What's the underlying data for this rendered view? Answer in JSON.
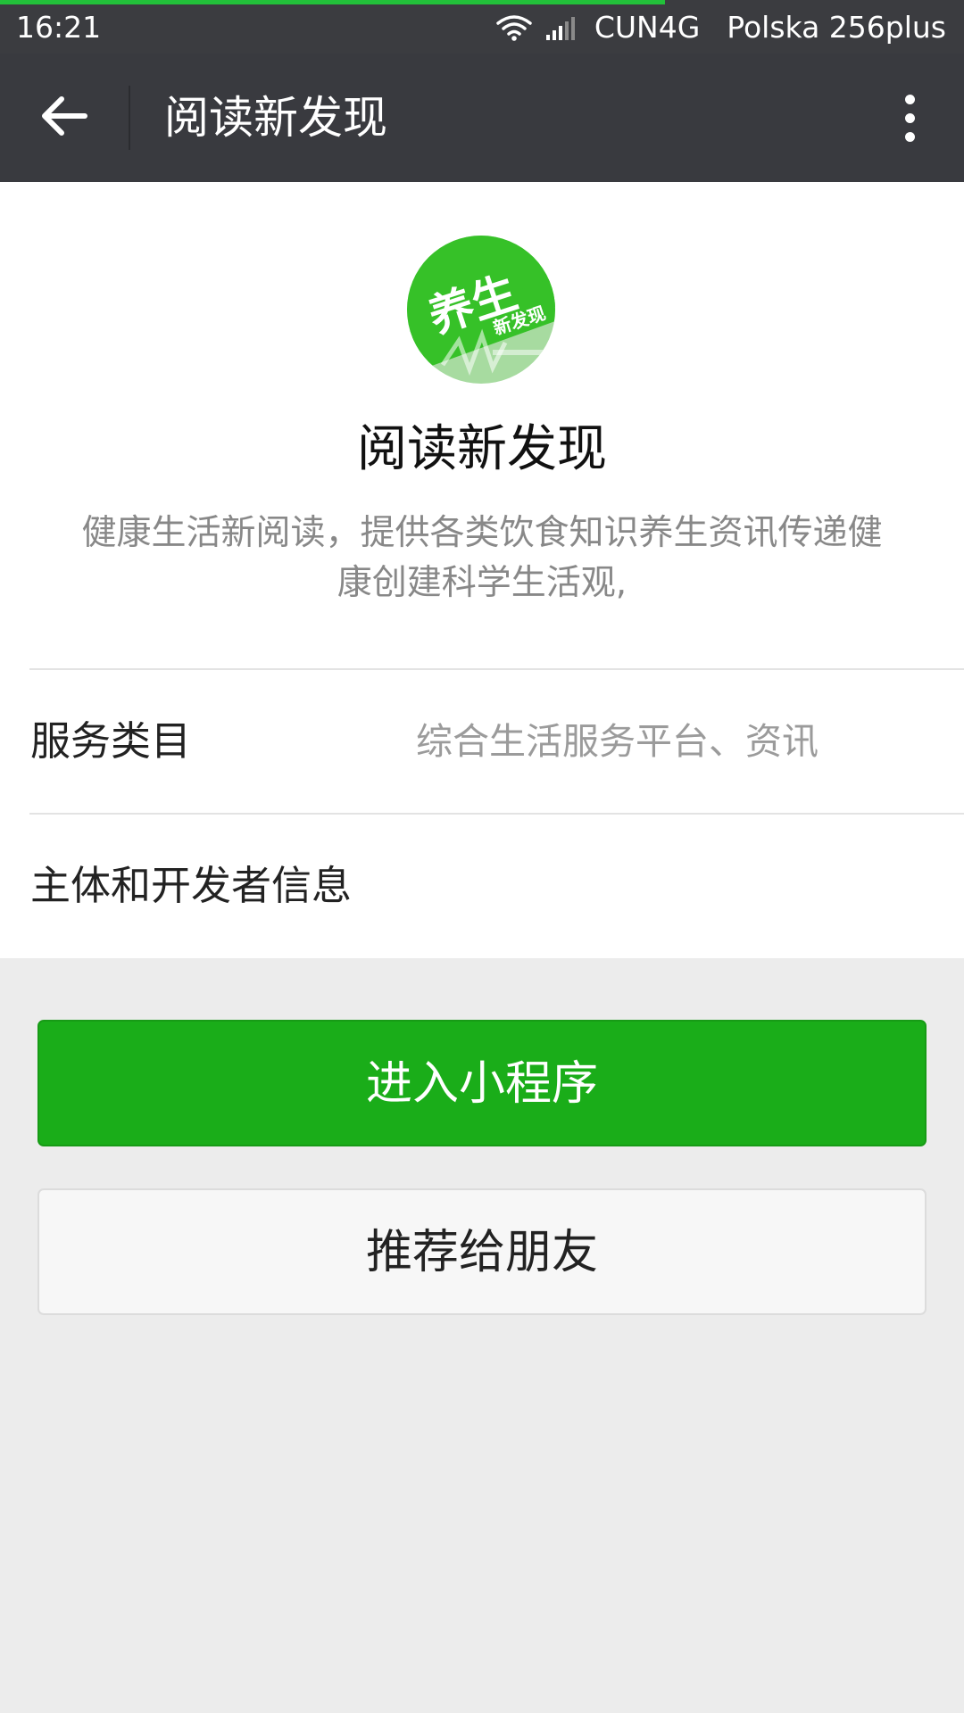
{
  "status_bar": {
    "time": "16:21",
    "carrier": "CUN4G",
    "carrier2": "Polska 256plus",
    "load_progress_percent": 69
  },
  "action_bar": {
    "title": "阅读新发现"
  },
  "profile": {
    "logo": {
      "big_text": "养生",
      "small_text": "新发现",
      "color": "#36c128"
    },
    "name": "阅读新发现",
    "description_line1": "健康生活新阅读，提供各类饮食知识养生资讯传递健",
    "description_line2": "康创建科学生活观,"
  },
  "rows": {
    "service_category": {
      "label": "服务类目",
      "value": "综合生活服务平台、资讯"
    },
    "developer_info": {
      "label": "主体和开发者信息"
    }
  },
  "buttons": {
    "enter": "进入小程序",
    "recommend": "推荐给朋友"
  },
  "colors": {
    "status_bar_bg": "#3b3c40",
    "action_bar_bg": "#393a3f",
    "primary_green": "#1aad19",
    "progress_green": "#22c03a"
  }
}
